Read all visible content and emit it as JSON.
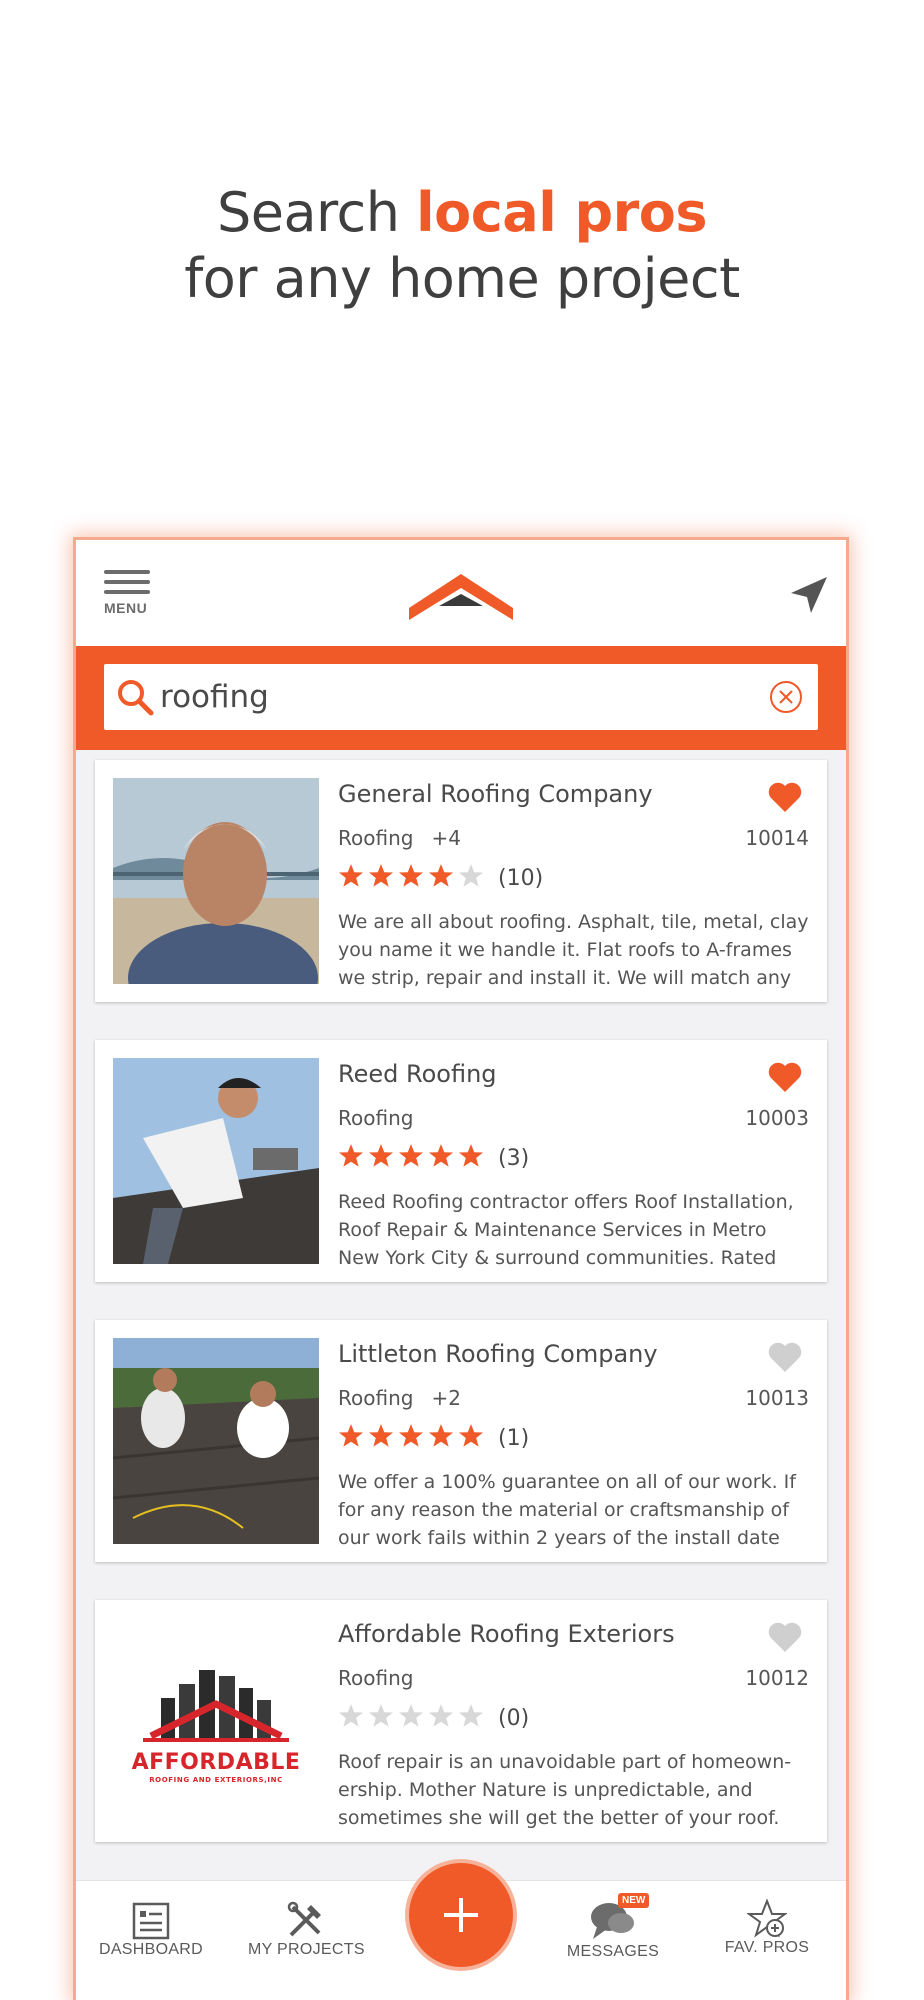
{
  "headline": {
    "prefix": "Search ",
    "accent": "local pros",
    "line2": "for any home project"
  },
  "colors": {
    "accent": "#f05a28",
    "text": "#4a4a4a",
    "star_empty": "#d8d8d8",
    "heart_inactive": "#cfcfcf"
  },
  "app": {
    "menu_label": "MENU",
    "search": {
      "value": "roofing",
      "icon": "search-icon",
      "clear_icon": "clear-icon"
    },
    "results": [
      {
        "name": "General Roofing Company",
        "category": "Roofing",
        "extra": "+4",
        "zip": "10014",
        "rating": 4,
        "count": "(10)",
        "favorite": true,
        "description": "We are all about roofing. Asphalt, tile, metal, clay you name it we handle it. Flat roofs to A-frames we strip, repair and install it. We will match any"
      },
      {
        "name": "Reed Roofing",
        "category": "Roofing",
        "extra": "",
        "zip": "10003",
        "rating": 5,
        "count": "(3)",
        "favorite": true,
        "description": "Reed Roofing contractor offers Roof Installation, Roof Repair & Maintenance Services in Metro New York City & surround communities. Rated"
      },
      {
        "name": "Littleton Roofing Company",
        "category": "Roofing",
        "extra": "+2",
        "zip": "10013",
        "rating": 5,
        "count": "(1)",
        "favorite": false,
        "description": "We offer a 100% guarantee on all of our work. If for any reason the material or craftsmanship of our work fails within 2 years of the install date"
      },
      {
        "name": "Affordable Roofing Exteriors",
        "category": "Roofing",
        "extra": "",
        "zip": "10012",
        "rating": 0,
        "count": "(0)",
        "favorite": false,
        "description": "Roof repair is an unavoidable part of homeown-ership. Mother Nature is unpredictable, and sometimes she will get the better of your roof.",
        "logo_text": "AFFORDABLE",
        "logo_subtext": "ROOFING AND EXTERIORS,INC"
      }
    ],
    "nav": {
      "dashboard": "DASHBOARD",
      "projects": "MY PROJECTS",
      "messages": "MESSAGES",
      "messages_badge": "NEW",
      "favorites": "FAV. PROS"
    }
  }
}
